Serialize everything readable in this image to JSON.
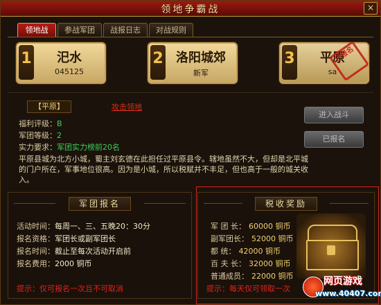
{
  "window": {
    "title": "领地争霸战",
    "close_label": "×"
  },
  "tabs": [
    {
      "label": "领地战",
      "active": true
    },
    {
      "label": "参战军团",
      "active": false
    },
    {
      "label": "战报日志",
      "active": false
    },
    {
      "label": "对战规则",
      "active": false
    }
  ],
  "territories": [
    {
      "num": "1",
      "name": "汜水",
      "sub": "045125"
    },
    {
      "num": "2",
      "name": "洛阳城郊",
      "sub": "新军"
    },
    {
      "num": "3",
      "name": "平原",
      "sub": "sa",
      "selected": true,
      "seal": "已报名"
    }
  ],
  "detail": {
    "tag": "【平原】",
    "enemy_link": "攻击领地",
    "fields": [
      {
        "label": "福利评级：",
        "value": "B"
      },
      {
        "label": "军团等级：",
        "value": "2"
      },
      {
        "label": "实力要求：",
        "value": "军团实力榜前20名"
      }
    ],
    "description": "平原县城为北方小城，蜀主刘玄德在此担任过平原县令。辖地虽然不大，但却是北平城的门户所在，军事地位很高。因为是小城，所以税赋并不丰足，但也高于一般的城关收入。"
  },
  "buttons": {
    "enter": "进入战斗",
    "registered": "已报名"
  },
  "signup": {
    "title": "军团报名",
    "rows": [
      {
        "label": "活动时间：",
        "value": "每周一、三、五晚20：30分"
      },
      {
        "label": "报名资格：",
        "value": "军团长或副军团长"
      },
      {
        "label": "报名时间：",
        "value": "截止至每次活动开启前"
      },
      {
        "label": "报名费用：",
        "value": "2000 铜币"
      }
    ],
    "tip": "提示：仅可报名一次且不可取消"
  },
  "tax": {
    "title": "税收奖励",
    "rows": [
      {
        "role": "军 团 长：",
        "amount": "60000 铜币"
      },
      {
        "role": "副军团长：",
        "amount": "52000 铜币"
      },
      {
        "role": "都    统：",
        "amount": "42000 铜币"
      },
      {
        "role": "百 夫 长：",
        "amount": "32000 铜币"
      },
      {
        "role": "普通成员：",
        "amount": "22000 铜币"
      }
    ],
    "tip": "提示：每天仅可领取一次"
  },
  "watermark": {
    "title": "网页游戏",
    "url": "www.40407.com"
  }
}
